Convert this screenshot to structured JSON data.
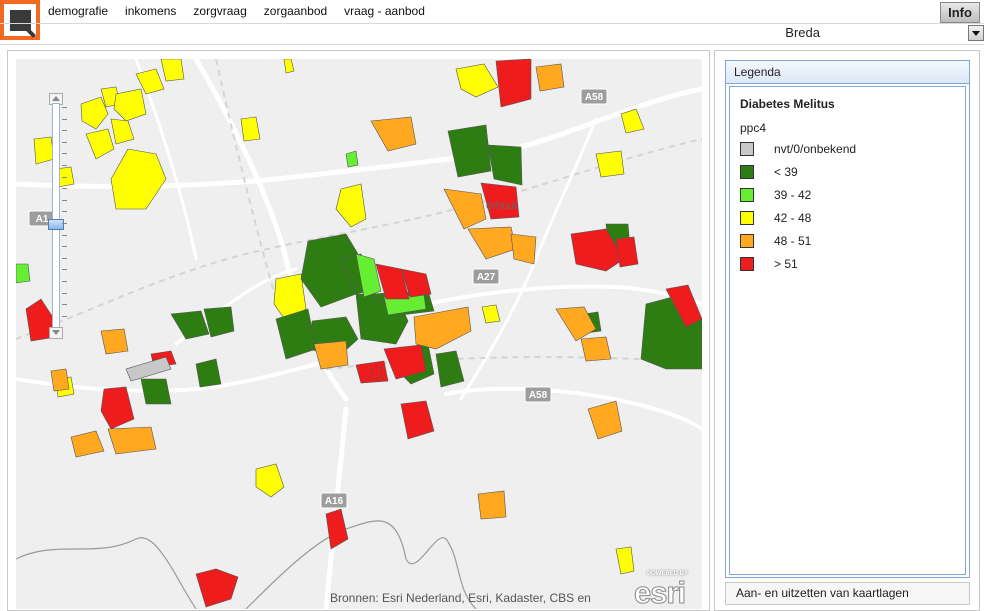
{
  "nav": [
    "demografie",
    "inkomens",
    "zorgvraag",
    "zorgaanbod",
    "vraag - aanbod"
  ],
  "info_label": "Info",
  "city": "Breda",
  "map": {
    "attribution": "Bronnen: Esri Nederland, Esri, Kadaster, CBS en",
    "esri_powered": "POWERED BY",
    "esri_logo": "esri",
    "road_labels": [
      "A58",
      "A27",
      "A58",
      "A16",
      "A1"
    ],
    "place_labels": [
      "erhout"
    ]
  },
  "legend": {
    "header": "Legenda",
    "title": "Diabetes Melitus",
    "subtitle": "ppc4",
    "items": [
      {
        "label": "nvt/0/onbekend",
        "color": "#c8c8c8"
      },
      {
        "label": "< 39",
        "color": "#2e7d12"
      },
      {
        "label": "39 - 42",
        "color": "#66ee33"
      },
      {
        "label": "42 - 48",
        "color": "#ffff00"
      },
      {
        "label": "48 - 51",
        "color": "#ffa820"
      },
      {
        "label": "> 51",
        "color": "#ee1c1c"
      }
    ],
    "layers_button": "Aan- en uitzetten van kaartlagen"
  }
}
